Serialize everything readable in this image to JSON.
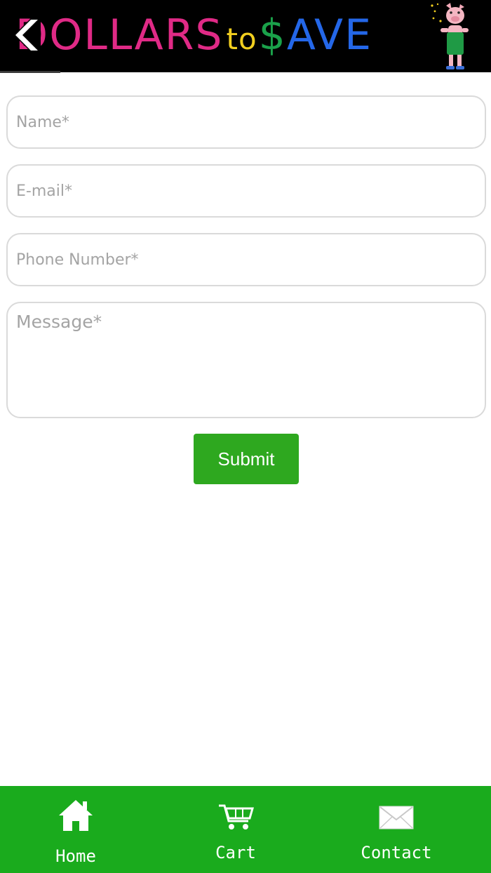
{
  "header": {
    "logo": {
      "part1": "DOLLARS",
      "part2": "to",
      "part3": "$",
      "part4": "AVE"
    },
    "colors": {
      "background": "#000000",
      "dollars": "#e02a86",
      "to": "#f2cf1f",
      "dollar_sign": "#1aa14a",
      "ave": "#2467e8"
    },
    "back_icon": "back-arrow-icon",
    "mascot_icon": "pig-mascot-icon"
  },
  "form": {
    "name_placeholder": "Name*",
    "email_placeholder": "E-mail*",
    "phone_placeholder": "Phone Number*",
    "message_placeholder": "Message*",
    "submit_label": "Submit",
    "submit_color": "#2ea81f"
  },
  "bottom_nav": {
    "background": "#1aab1d",
    "items": [
      {
        "label": "Home",
        "icon": "home-icon"
      },
      {
        "label": "Cart",
        "icon": "cart-icon"
      },
      {
        "label": "Contact",
        "icon": "mail-icon"
      }
    ]
  }
}
